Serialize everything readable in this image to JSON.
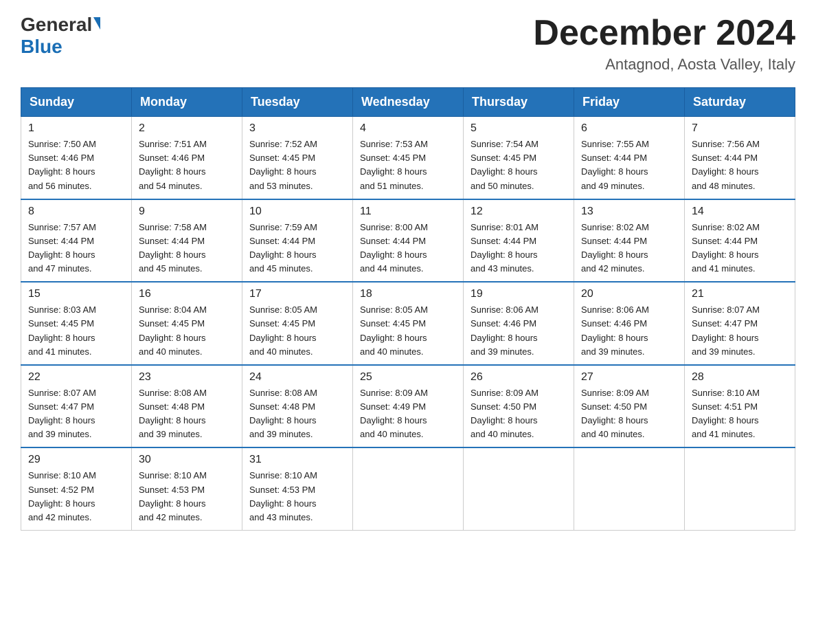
{
  "header": {
    "logo_line1": "General",
    "logo_line2": "Blue",
    "month_title": "December 2024",
    "location": "Antagnod, Aosta Valley, Italy"
  },
  "days_of_week": [
    "Sunday",
    "Monday",
    "Tuesday",
    "Wednesday",
    "Thursday",
    "Friday",
    "Saturday"
  ],
  "weeks": [
    [
      {
        "day": "1",
        "sunrise": "7:50 AM",
        "sunset": "4:46 PM",
        "daylight": "8 hours and 56 minutes."
      },
      {
        "day": "2",
        "sunrise": "7:51 AM",
        "sunset": "4:46 PM",
        "daylight": "8 hours and 54 minutes."
      },
      {
        "day": "3",
        "sunrise": "7:52 AM",
        "sunset": "4:45 PM",
        "daylight": "8 hours and 53 minutes."
      },
      {
        "day": "4",
        "sunrise": "7:53 AM",
        "sunset": "4:45 PM",
        "daylight": "8 hours and 51 minutes."
      },
      {
        "day": "5",
        "sunrise": "7:54 AM",
        "sunset": "4:45 PM",
        "daylight": "8 hours and 50 minutes."
      },
      {
        "day": "6",
        "sunrise": "7:55 AM",
        "sunset": "4:44 PM",
        "daylight": "8 hours and 49 minutes."
      },
      {
        "day": "7",
        "sunrise": "7:56 AM",
        "sunset": "4:44 PM",
        "daylight": "8 hours and 48 minutes."
      }
    ],
    [
      {
        "day": "8",
        "sunrise": "7:57 AM",
        "sunset": "4:44 PM",
        "daylight": "8 hours and 47 minutes."
      },
      {
        "day": "9",
        "sunrise": "7:58 AM",
        "sunset": "4:44 PM",
        "daylight": "8 hours and 45 minutes."
      },
      {
        "day": "10",
        "sunrise": "7:59 AM",
        "sunset": "4:44 PM",
        "daylight": "8 hours and 45 minutes."
      },
      {
        "day": "11",
        "sunrise": "8:00 AM",
        "sunset": "4:44 PM",
        "daylight": "8 hours and 44 minutes."
      },
      {
        "day": "12",
        "sunrise": "8:01 AM",
        "sunset": "4:44 PM",
        "daylight": "8 hours and 43 minutes."
      },
      {
        "day": "13",
        "sunrise": "8:02 AM",
        "sunset": "4:44 PM",
        "daylight": "8 hours and 42 minutes."
      },
      {
        "day": "14",
        "sunrise": "8:02 AM",
        "sunset": "4:44 PM",
        "daylight": "8 hours and 41 minutes."
      }
    ],
    [
      {
        "day": "15",
        "sunrise": "8:03 AM",
        "sunset": "4:45 PM",
        "daylight": "8 hours and 41 minutes."
      },
      {
        "day": "16",
        "sunrise": "8:04 AM",
        "sunset": "4:45 PM",
        "daylight": "8 hours and 40 minutes."
      },
      {
        "day": "17",
        "sunrise": "8:05 AM",
        "sunset": "4:45 PM",
        "daylight": "8 hours and 40 minutes."
      },
      {
        "day": "18",
        "sunrise": "8:05 AM",
        "sunset": "4:45 PM",
        "daylight": "8 hours and 40 minutes."
      },
      {
        "day": "19",
        "sunrise": "8:06 AM",
        "sunset": "4:46 PM",
        "daylight": "8 hours and 39 minutes."
      },
      {
        "day": "20",
        "sunrise": "8:06 AM",
        "sunset": "4:46 PM",
        "daylight": "8 hours and 39 minutes."
      },
      {
        "day": "21",
        "sunrise": "8:07 AM",
        "sunset": "4:47 PM",
        "daylight": "8 hours and 39 minutes."
      }
    ],
    [
      {
        "day": "22",
        "sunrise": "8:07 AM",
        "sunset": "4:47 PM",
        "daylight": "8 hours and 39 minutes."
      },
      {
        "day": "23",
        "sunrise": "8:08 AM",
        "sunset": "4:48 PM",
        "daylight": "8 hours and 39 minutes."
      },
      {
        "day": "24",
        "sunrise": "8:08 AM",
        "sunset": "4:48 PM",
        "daylight": "8 hours and 39 minutes."
      },
      {
        "day": "25",
        "sunrise": "8:09 AM",
        "sunset": "4:49 PM",
        "daylight": "8 hours and 40 minutes."
      },
      {
        "day": "26",
        "sunrise": "8:09 AM",
        "sunset": "4:50 PM",
        "daylight": "8 hours and 40 minutes."
      },
      {
        "day": "27",
        "sunrise": "8:09 AM",
        "sunset": "4:50 PM",
        "daylight": "8 hours and 40 minutes."
      },
      {
        "day": "28",
        "sunrise": "8:10 AM",
        "sunset": "4:51 PM",
        "daylight": "8 hours and 41 minutes."
      }
    ],
    [
      {
        "day": "29",
        "sunrise": "8:10 AM",
        "sunset": "4:52 PM",
        "daylight": "8 hours and 42 minutes."
      },
      {
        "day": "30",
        "sunrise": "8:10 AM",
        "sunset": "4:53 PM",
        "daylight": "8 hours and 42 minutes."
      },
      {
        "day": "31",
        "sunrise": "8:10 AM",
        "sunset": "4:53 PM",
        "daylight": "8 hours and 43 minutes."
      },
      null,
      null,
      null,
      null
    ]
  ],
  "labels": {
    "sunrise": "Sunrise:",
    "sunset": "Sunset:",
    "daylight": "Daylight:"
  }
}
